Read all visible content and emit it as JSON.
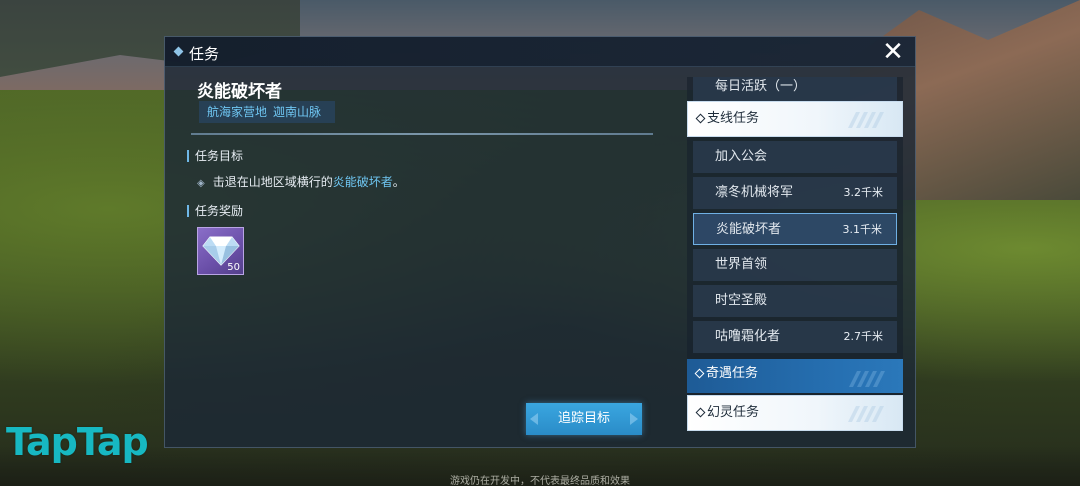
{
  "window": {
    "title": "任务",
    "close_glyph": "✕"
  },
  "quest": {
    "name": "炎能破坏者",
    "location": [
      "航海家营地",
      "迦南山脉"
    ],
    "goal_section_title": "任务目标",
    "goal_prefix": "击退在山地区域横行的",
    "goal_highlight": "炎能破坏者",
    "goal_suffix": "。",
    "reward_section_title": "任务奖励",
    "reward_item_icon": "diamond-icon",
    "reward_count": "50",
    "track_button_label": "追踪目标"
  },
  "list": {
    "top_partial": "每日活跃（一）",
    "categories": {
      "side": "支线任务",
      "encounter": "奇遇任务",
      "phantom": "幻灵任务"
    },
    "items": [
      {
        "label": "加入公会",
        "distance": ""
      },
      {
        "label": "凛冬机械将军",
        "distance": "3.2千米"
      },
      {
        "label": "炎能破坏者",
        "distance": "3.1千米",
        "selected": true
      },
      {
        "label": "世界首领",
        "distance": ""
      },
      {
        "label": "时空圣殿",
        "distance": ""
      },
      {
        "label": "咕噜霜化者",
        "distance": "2.7千米"
      }
    ]
  },
  "watermark": "TapTap",
  "footer_note": "游戏仍在开发中，不代表最终品质和效果",
  "colors": {
    "accent_blue": "#6fc6f2",
    "button_blue": "#2a8cc8",
    "reward_purple": "#6a4fa8",
    "taptap_teal": "#17b8c2"
  }
}
